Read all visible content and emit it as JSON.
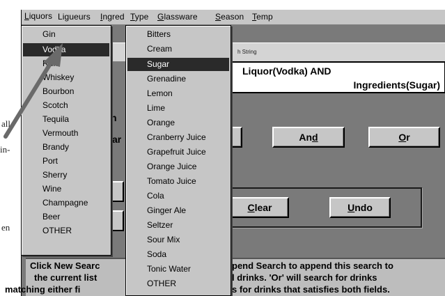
{
  "menubar": {
    "items": [
      {
        "label": "Liquors",
        "u": "L",
        "rest": "iquors"
      },
      {
        "label": "Ligueurs",
        "u": "",
        "rest": "Ligueurs"
      },
      {
        "label": "Ingred",
        "u": "I",
        "rest": "ngred"
      },
      {
        "label": "Type",
        "u": "T",
        "rest": "ype"
      },
      {
        "label": "Glassware",
        "u": "G",
        "rest": "lassware"
      },
      {
        "label": "Season",
        "u": "S",
        "rest": "eason"
      },
      {
        "label": "Temp",
        "u": "T",
        "rest": "emp"
      }
    ]
  },
  "liquors_menu": {
    "items": [
      "Gin",
      "Vodka",
      "Rum",
      "Whiskey",
      "Bourbon",
      "Scotch",
      "Tequila",
      "Vermouth",
      "Brandy",
      "Port",
      "Sherry",
      "Wine",
      "Champagne",
      "Beer",
      "OTHER"
    ],
    "selected": "Vodka"
  },
  "ingred_menu": {
    "items": [
      "Bitters",
      "Cream",
      "Sugar",
      "Grenadine",
      "Lemon",
      "Lime",
      "Orange",
      "Cranberry Juice",
      "Grapefruit Juice",
      "Orange Juice",
      "Tomato Juice",
      "Cola",
      "Ginger Ale",
      "Seltzer",
      "Sour Mix",
      "Soda",
      "Tonic Water",
      "OTHER"
    ],
    "selected": "Sugar"
  },
  "search": {
    "header_label": "h String",
    "line1": "Liquor(Vodka) AND",
    "line2": "Ingredients(Sugar)"
  },
  "buttons": {
    "and_pre": "An",
    "and_u": "d",
    "or_u": "O",
    "or_rest": "r",
    "clear_u": "C",
    "clear_rest": "lear",
    "undo_u": "U",
    "undo_rest": "ndo"
  },
  "left_fragments": {
    "h": "h",
    "ar": "ar"
  },
  "margin": {
    "all": "all",
    "in": "in-",
    "en": "en"
  },
  "help": {
    "line1a": "Click New Searc",
    "line1b": "pend Search to append this search to",
    "line2a": "the current list",
    "line2b": "l drinks.  'Or' will search for drinks",
    "line3a": "matching either fi",
    "line3b": "s for drinks that satisfies both fields."
  },
  "colors": {
    "selection": "#2a2a2a",
    "menu_bg": "#c6c6c6",
    "window_bg": "#7a7a7a",
    "arrow": "#6a6a6a"
  }
}
